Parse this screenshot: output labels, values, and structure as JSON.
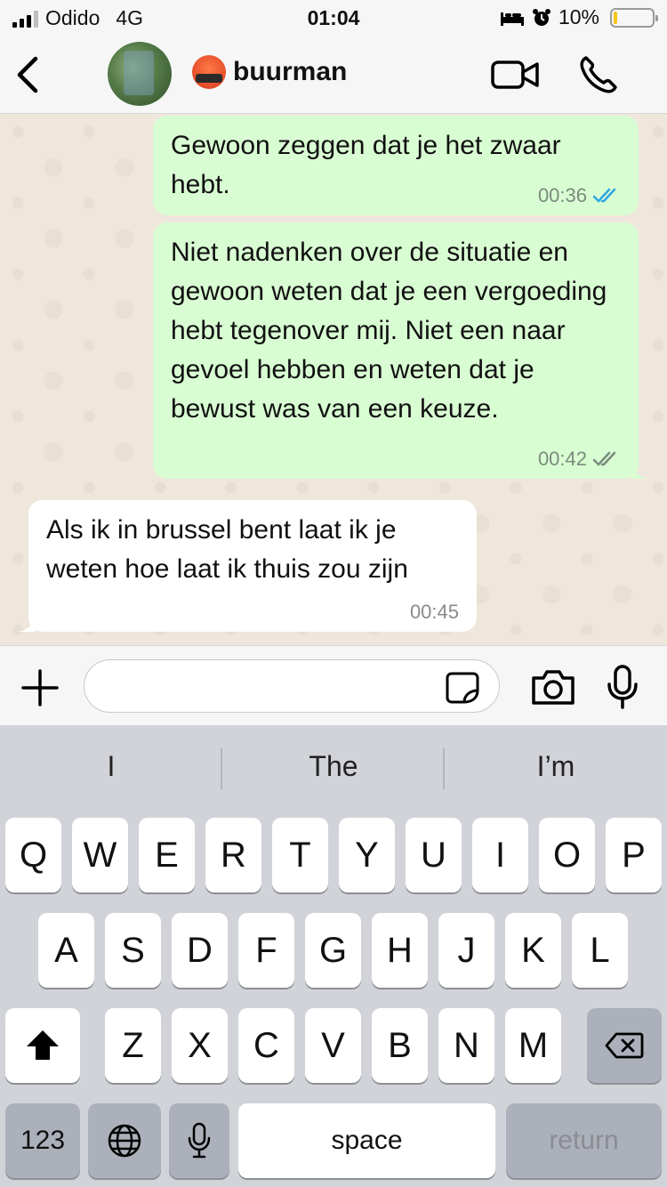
{
  "status_bar": {
    "carrier": "Odido",
    "network": "4G",
    "time": "01:04",
    "battery_percent": "10%",
    "battery_level": 0.1
  },
  "header": {
    "contact_name": "buurman",
    "icons": [
      "back-chevron-icon",
      "avatar",
      "angry-face-emoji",
      "video-call-icon",
      "phone-call-icon"
    ]
  },
  "messages": [
    {
      "direction": "outgoing",
      "text": "Gewoon zeggen dat je het zwaar hebt.",
      "time": "00:36",
      "status": "read",
      "tick_color": "#2fa5e0"
    },
    {
      "direction": "outgoing",
      "text": "Niet nadenken over de situatie en gewoon weten dat je een vergoeding hebt tegenover mij. Niet een naar gevoel hebben en weten dat je bewust was van een keuze.",
      "time": "00:42",
      "status": "delivered",
      "tick_color": "#7b8a7d"
    },
    {
      "direction": "incoming",
      "text": "Als ik in brussel bent laat ik je weten hoe laat ik thuis zou zijn",
      "time": "00:45"
    }
  ],
  "composer": {
    "value": "",
    "placeholder": ""
  },
  "keyboard": {
    "suggestions": [
      "I",
      "The",
      "I’m"
    ],
    "row1": [
      "Q",
      "W",
      "E",
      "R",
      "T",
      "Y",
      "U",
      "I",
      "O",
      "P"
    ],
    "row2": [
      "A",
      "S",
      "D",
      "F",
      "G",
      "H",
      "J",
      "K",
      "L"
    ],
    "row3": [
      "Z",
      "X",
      "C",
      "V",
      "B",
      "N",
      "M"
    ],
    "numbers_label": "123",
    "space_label": "space",
    "return_label": "return"
  },
  "colors": {
    "outgoing_bubble": "#d9fdd3",
    "incoming_bubble": "#ffffff",
    "chat_background": "#efe7dc",
    "battery_fill": "#f5c518"
  }
}
